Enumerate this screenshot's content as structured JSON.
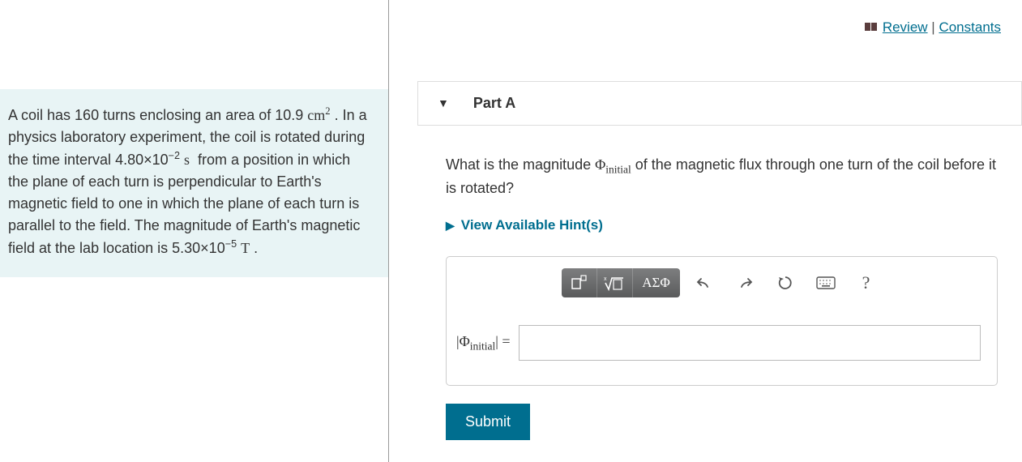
{
  "top_links": {
    "review": "Review",
    "separator": " | ",
    "constants": "Constants"
  },
  "problem": {
    "turns": "160",
    "area_val": "10.9",
    "time_val": "4.80",
    "time_exp": "−2",
    "field_val": "5.30",
    "field_exp": "−5"
  },
  "part": {
    "label": "Part A",
    "question_prefix": "What is the magnitude ",
    "question_suffix": " of the magnetic flux through one turn of the coil before it is rotated?",
    "symbol_sub": "initial"
  },
  "hints": {
    "label": "View Available Hint(s)"
  },
  "toolbar": {
    "greek": "ΑΣΦ",
    "help": "?"
  },
  "input": {
    "equals": " = "
  },
  "submit": {
    "label": "Submit"
  }
}
